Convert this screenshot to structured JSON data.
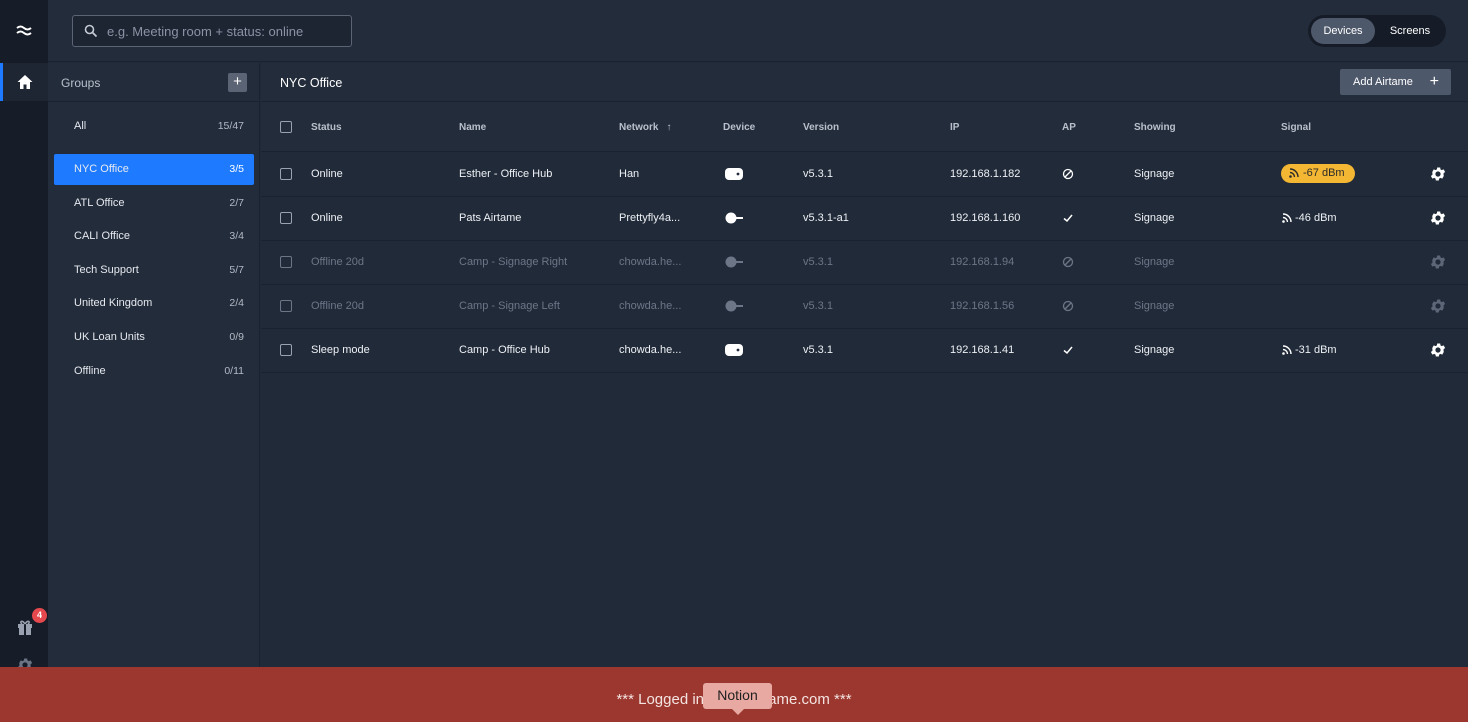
{
  "search": {
    "placeholder": "e.g. Meeting room + status: online"
  },
  "view_toggle": {
    "devices": "Devices",
    "screens": "Screens",
    "selected": "Devices"
  },
  "rail": {
    "gift_badge": "4"
  },
  "groups": {
    "title": "Groups",
    "add_label": "+",
    "items": [
      {
        "label": "All",
        "count": "15/47",
        "active": false
      },
      {
        "label": "NYC Office",
        "count": "3/5",
        "active": true
      },
      {
        "label": "ATL Office",
        "count": "2/7",
        "active": false
      },
      {
        "label": "CALI Office",
        "count": "3/4",
        "active": false
      },
      {
        "label": "Tech Support",
        "count": "5/7",
        "active": false
      },
      {
        "label": "United Kingdom",
        "count": "2/4",
        "active": false
      },
      {
        "label": "UK Loan Units",
        "count": "0/9",
        "active": false
      },
      {
        "label": "Offline",
        "count": "0/11",
        "active": false
      }
    ]
  },
  "main": {
    "title": "NYC Office",
    "add_button": "Add Airtame",
    "add_plus": "+",
    "columns": {
      "status": "Status",
      "name": "Name",
      "network": "Network",
      "sort_arrow": "↑",
      "device": "Device",
      "version": "Version",
      "ip": "IP",
      "ap": "AP",
      "showing": "Showing",
      "signal": "Signal"
    },
    "rows": [
      {
        "status": "Online",
        "name": "Esther - Office Hub",
        "network": "Han",
        "device": "hub-device",
        "version": "v5.3.1",
        "ip": "192.168.1.182",
        "ap": "disabled",
        "showing": "Signage",
        "signal": "-67 dBm",
        "signal_warn": true,
        "offline": false
      },
      {
        "status": "Online",
        "name": "Pats Airtame",
        "network": "Prettyfly4a...",
        "device": "dongle-device",
        "version": "v5.3.1-a1",
        "ip": "192.168.1.160",
        "ap": "enabled",
        "showing": "Signage",
        "signal": "-46 dBm",
        "signal_warn": false,
        "offline": false
      },
      {
        "status": "Offline 20d",
        "name": "Camp - Signage Right",
        "network": "chowda.he...",
        "device": "dongle-device",
        "version": "v5.3.1",
        "ip": "192.168.1.94",
        "ap": "disabled",
        "showing": "Signage",
        "signal": "",
        "signal_warn": false,
        "offline": true
      },
      {
        "status": "Offline 20d",
        "name": "Camp - Signage Left",
        "network": "chowda.he...",
        "device": "dongle-device",
        "version": "v5.3.1",
        "ip": "192.168.1.56",
        "ap": "disabled",
        "showing": "Signage",
        "signal": "",
        "signal_warn": false,
        "offline": true
      },
      {
        "status": "Sleep mode",
        "name": "Camp - Office Hub",
        "network": "chowda.he...",
        "device": "hub-device",
        "version": "v5.3.1",
        "ip": "192.168.1.41",
        "ap": "enabled",
        "showing": "Signage",
        "signal": "-31 dBm",
        "signal_warn": false,
        "offline": false
      }
    ]
  },
  "banner": {
    "text": "*** Logged in as ··· airtame.com ***"
  },
  "tooltip": {
    "text": "Notion"
  },
  "colors": {
    "accent": "#1e7bff",
    "warning": "#f4b733",
    "banner": "#9b372f",
    "badge": "#e5484d"
  }
}
